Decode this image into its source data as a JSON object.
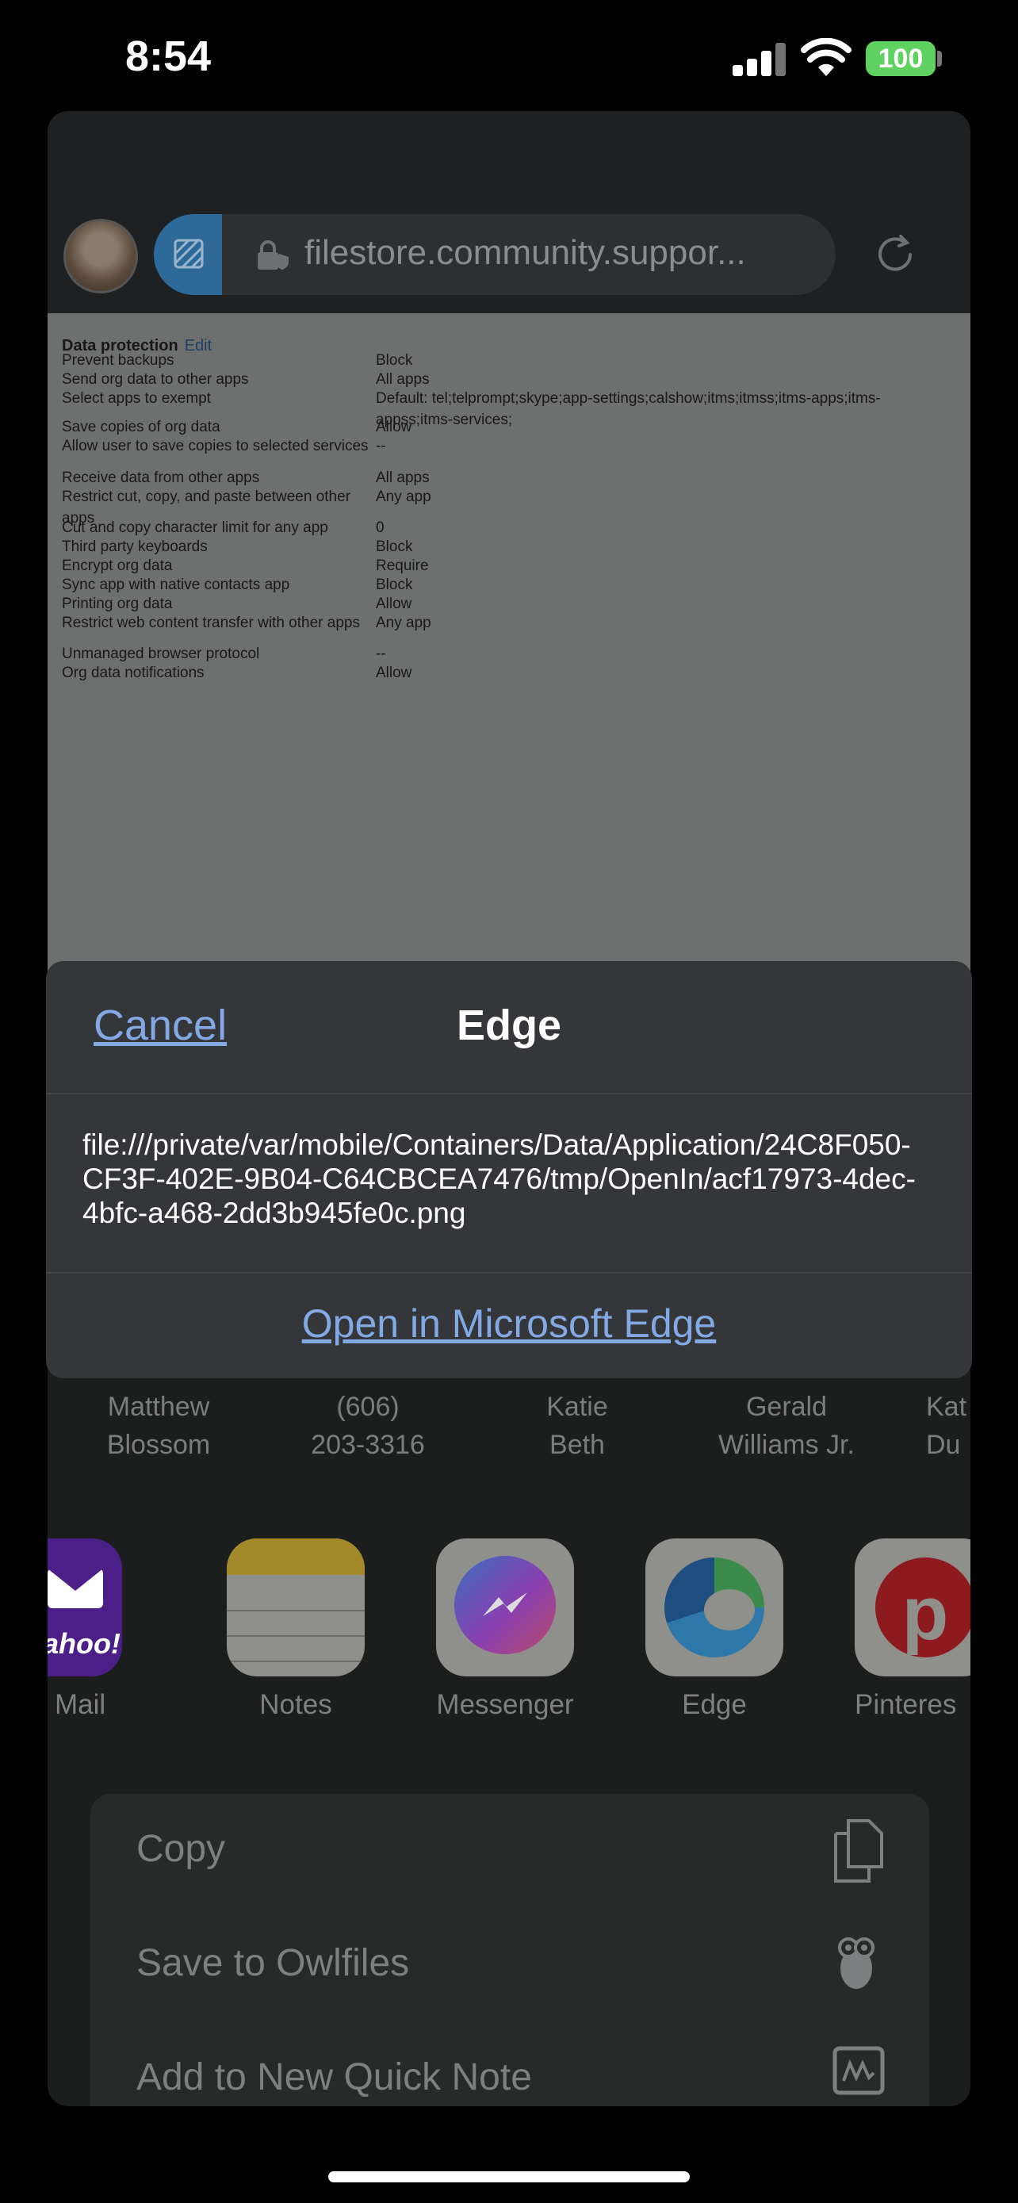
{
  "status_bar": {
    "time": "8:54",
    "battery": "100"
  },
  "browser": {
    "url": "filestore.community.suppor..."
  },
  "webpage": {
    "section_title": "Data protection",
    "edit_link": "Edit",
    "rows": [
      {
        "label": "Prevent backups",
        "value": "Block"
      },
      {
        "label": "Send org data to other apps",
        "value": "All apps"
      },
      {
        "label": "Select apps to exempt",
        "value": "Default: tel;telprompt;skype;app-settings;calshow;itms;itmss;itms-apps;itms-appss;itms-services;"
      },
      {
        "label": "Save copies of org data",
        "value": "Allow"
      },
      {
        "label": "Allow user to save copies to selected services",
        "value": "--"
      },
      {
        "label": "Receive data from other apps",
        "value": "All apps"
      },
      {
        "label": "Restrict cut, copy, and paste between other apps",
        "value": "Any app"
      },
      {
        "label": "Cut and copy character limit for any app",
        "value": "0"
      },
      {
        "label": "Third party keyboards",
        "value": "Block"
      },
      {
        "label": "Encrypt org data",
        "value": "Require"
      },
      {
        "label": "Sync app with native contacts app",
        "value": "Block"
      },
      {
        "label": "Printing org data",
        "value": "Allow"
      },
      {
        "label": "Restrict web content transfer with other apps",
        "value": "Any app"
      },
      {
        "label": "Unmanaged browser protocol",
        "value": "--"
      },
      {
        "label": "Org data notifications",
        "value": "Allow"
      }
    ]
  },
  "contacts": [
    {
      "line1": "Matthew",
      "line2": "Blossom"
    },
    {
      "line1": "(606)",
      "line2": "203-3316"
    },
    {
      "line1": "Katie",
      "line2": "Beth"
    },
    {
      "line1": "Gerald",
      "line2": "Williams Jr."
    },
    {
      "line1": "Kat",
      "line2": "Du"
    }
  ],
  "apps": [
    {
      "label": "hoo Mail",
      "icon_text": "yahoo!",
      "icon": "yahoo-mail-icon"
    },
    {
      "label": "Notes",
      "icon": "notes-icon"
    },
    {
      "label": "Messenger",
      "icon": "messenger-icon"
    },
    {
      "label": "Edge",
      "icon": "edge-icon"
    },
    {
      "label": "Pinteres",
      "icon": "pinterest-icon"
    }
  ],
  "actions": [
    {
      "label": "Copy",
      "icon": "copy-icon"
    },
    {
      "label": "Save to Owlfiles",
      "icon": "owl-icon"
    },
    {
      "label": "Add to New Quick Note",
      "icon": "quick-note-icon"
    }
  ],
  "alert": {
    "cancel": "Cancel",
    "title": "Edge",
    "path": "file:///private/var/mobile/Containers/Data/Application/24C8F050-CF3F-402E-9B04-C64CBCEA7476/tmp/OpenIn/acf17973-4dec-4bfc-a468-2dd3b945fe0c.png",
    "open_button": "Open in Microsoft Edge"
  },
  "colors": {
    "link": "#82a9e4",
    "alert_bg": "#353639",
    "battery": "#5fd160"
  }
}
